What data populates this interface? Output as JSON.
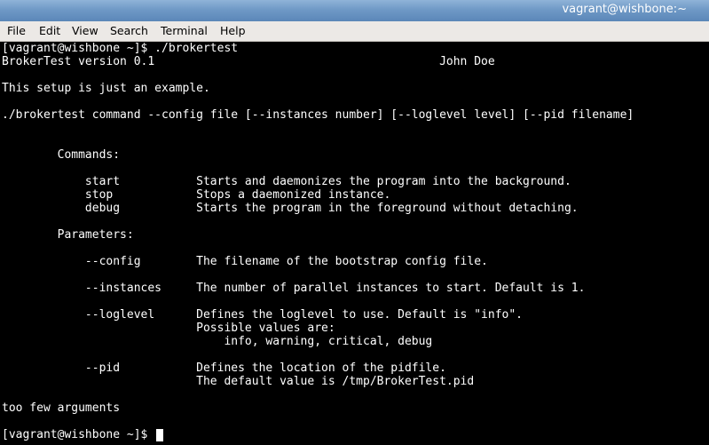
{
  "window": {
    "title": "vagrant@wishbone:~"
  },
  "menu": {
    "items": [
      "File",
      "Edit",
      "View",
      "Search",
      "Terminal",
      "Help"
    ]
  },
  "terminal": {
    "lines": [
      "[vagrant@wishbone ~]$ ./brokertest",
      "BrokerTest version 0.1                                         John Doe",
      "",
      "This setup is just an example.",
      "",
      "./brokertest command --config file [--instances number] [--loglevel level] [--pid filename]",
      "",
      "",
      "",
      "        Commands:",
      "",
      "            start           Starts and daemonizes the program into the background.",
      "            stop            Stops a daemonized instance.",
      "            debug           Starts the program in the foreground without detaching.",
      "",
      "        Parameters:",
      "",
      "            --config        The filename of the bootstrap config file.",
      "",
      "            --instances     The number of parallel instances to start. Default is 1.",
      "",
      "            --loglevel      Defines the loglevel to use. Default is \"info\".",
      "                            Possible values are:",
      "                                info, warning, critical, debug",
      "",
      "            --pid           Defines the location of the pidfile.",
      "                            The default value is /tmp/BrokerTest.pid",
      "",
      "too few arguments",
      "",
      "[vagrant@wishbone ~]$ "
    ]
  }
}
